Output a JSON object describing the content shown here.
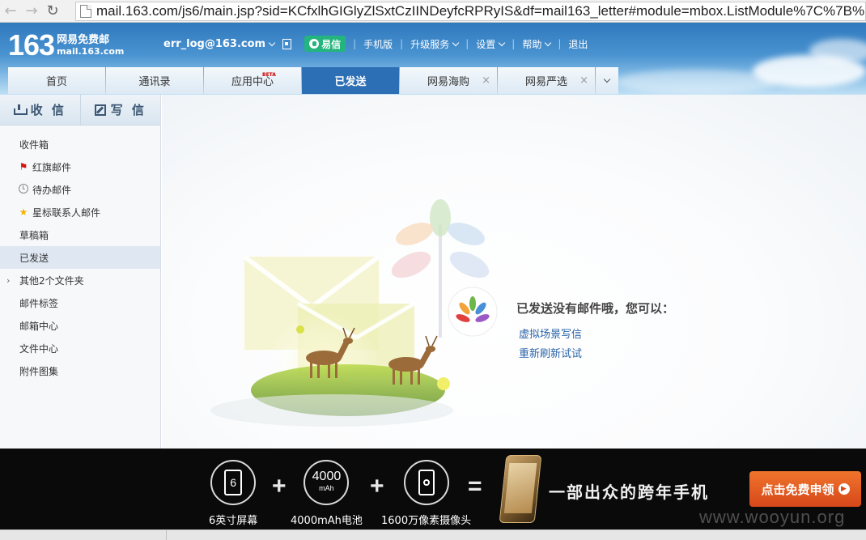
{
  "browser": {
    "url": "mail.163.com/js6/main.jsp?sid=KCfxlhGIGlyZlSxtCzIINDeyfcRPRyIS&df=mail163_letter#module=mbox.ListModule%7C%7B%"
  },
  "header": {
    "logo_number": "163",
    "logo_cn": "网易免费邮",
    "logo_domain": "mail.163.com",
    "user_email": "err_log@163.com",
    "yixin_label": "易信",
    "links": {
      "mobile": "手机版",
      "upgrade": "升级服务",
      "settings": "设置",
      "help": "帮助",
      "logout": "退出"
    }
  },
  "tabs": [
    {
      "label": "首页"
    },
    {
      "label": "通讯录"
    },
    {
      "label": "应用中心",
      "badge": "BETA"
    },
    {
      "label": "已发送"
    },
    {
      "label": "网易海购",
      "close": "×"
    },
    {
      "label": "网易严选",
      "close": "×"
    }
  ],
  "sidebar": {
    "receive_label": "收 信",
    "write_label": "写 信",
    "folders": [
      {
        "label": "收件箱"
      },
      {
        "label": "红旗邮件"
      },
      {
        "label": "待办邮件"
      },
      {
        "label": "星标联系人邮件"
      },
      {
        "label": "草稿箱"
      },
      {
        "label": "已发送"
      },
      {
        "label": "其他2个文件夹"
      },
      {
        "label": "邮件标签"
      },
      {
        "label": "邮箱中心"
      },
      {
        "label": "文件中心"
      },
      {
        "label": "附件图集"
      }
    ]
  },
  "main": {
    "empty_message": "已发送没有邮件哦，您可以：",
    "link_virtual": "虚拟场景写信",
    "link_refresh": "重新刷新试试"
  },
  "banner": {
    "screen_value": "6",
    "screen_label": "6英寸屏幕",
    "battery_value": "4000",
    "battery_unit": "mAh",
    "battery_label": "4000mAh电池",
    "camera_label": "1600万像素摄像头",
    "plus": "+",
    "equals": "=",
    "slogan": "一部出众的跨年手机",
    "cta_label": "点击免费申领",
    "watermark": "www.wooyun.org"
  },
  "colors": {
    "header_blue": "#2f79bd",
    "active_tab": "#2d6fb4",
    "yixin_green": "#24b47e",
    "link_blue": "#2a64a8",
    "cta_orange": "#e65f22"
  }
}
